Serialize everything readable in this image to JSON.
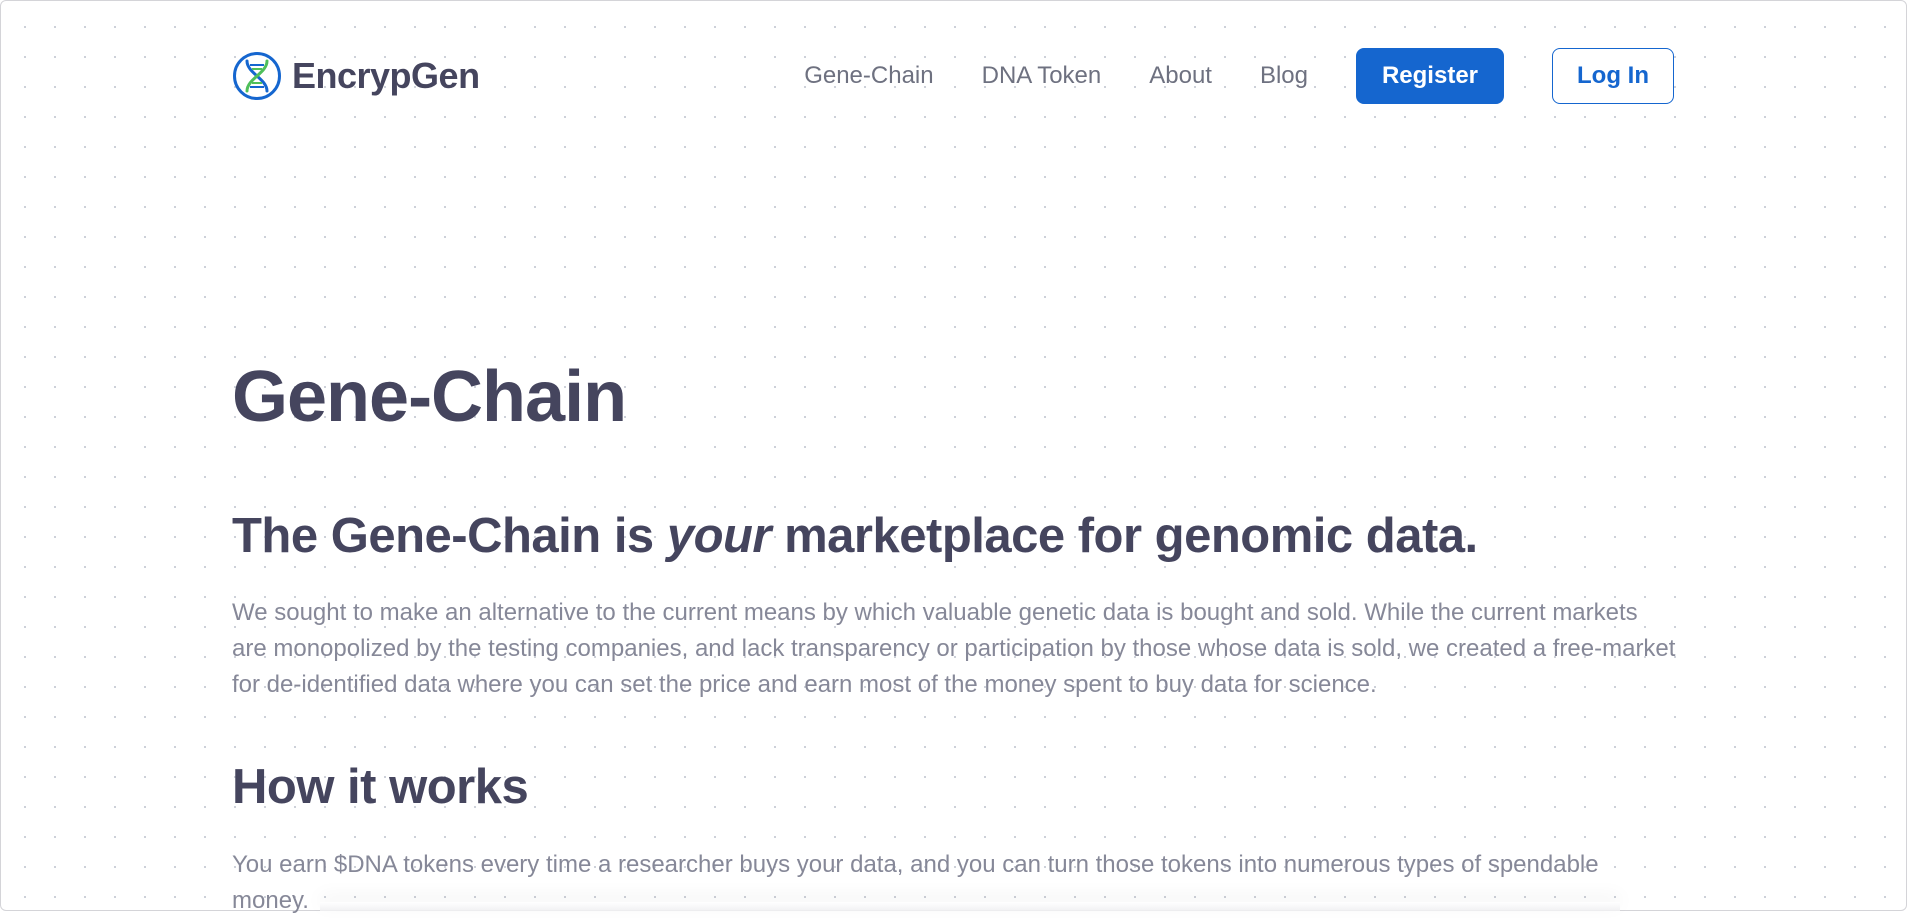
{
  "brand": {
    "name": "EncrypGen",
    "logo_icon": "dna-helix-icon",
    "colors": {
      "ring": "#1566cf",
      "strand_a": "#1566cf",
      "strand_b": "#4fbf5a"
    }
  },
  "nav": {
    "links": [
      {
        "label": "Gene-Chain"
      },
      {
        "label": "DNA Token"
      },
      {
        "label": "About"
      },
      {
        "label": "Blog"
      }
    ],
    "register_label": "Register",
    "login_label": "Log In"
  },
  "main": {
    "title": "Gene-Chain",
    "tagline": {
      "before": "The Gene-Chain is ",
      "emphasis": "your",
      "after": " marketplace for genomic data."
    },
    "intro": "We sought to make an alternative to the current means by which valuable genetic data is bought and sold. While the current markets are monopolized by the testing companies, and lack transparency or participation by those whose data is sold, we created a free-market for de-identified data where you can set the price and earn most of the money spent to buy data for science.",
    "how_title": "How it works",
    "how_text": "You earn $DNA tokens every time a researcher buys your data, and you can turn those tokens into numerous types of spendable money."
  },
  "theme": {
    "accent": "#1566cf",
    "heading_color": "#45455e",
    "body_text_color": "#868898",
    "nav_text_color": "#6e7180"
  }
}
